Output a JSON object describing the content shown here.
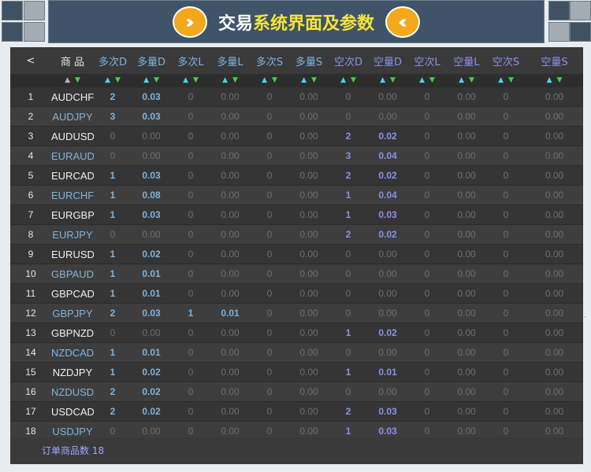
{
  "banner": {
    "title_white": "交易",
    "title_yellow": "系统界面及参数"
  },
  "header": {
    "back": "<",
    "product": "商 品",
    "columns": [
      "多次D",
      "多量D",
      "多次L",
      "多量L",
      "多次S",
      "多量S",
      "空次D",
      "空量D",
      "空次L",
      "空量L",
      "空次S",
      "空量S"
    ]
  },
  "rows": [
    {
      "n": "1",
      "sym": "AUDCHF",
      "v": [
        "2",
        "0.03",
        "0",
        "0.00",
        "0",
        "0.00",
        "0",
        "0.00",
        "0",
        "0.00",
        "0",
        "0.00"
      ]
    },
    {
      "n": "2",
      "sym": "AUDJPY",
      "v": [
        "3",
        "0.03",
        "0",
        "0.00",
        "0",
        "0.00",
        "0",
        "0.00",
        "0",
        "0.00",
        "0",
        "0.00"
      ]
    },
    {
      "n": "3",
      "sym": "AUDUSD",
      "v": [
        "0",
        "0.00",
        "0",
        "0.00",
        "0",
        "0.00",
        "2",
        "0.02",
        "0",
        "0.00",
        "0",
        "0.00"
      ]
    },
    {
      "n": "4",
      "sym": "EURAUD",
      "v": [
        "0",
        "0.00",
        "0",
        "0.00",
        "0",
        "0.00",
        "3",
        "0.04",
        "0",
        "0.00",
        "0",
        "0.00"
      ]
    },
    {
      "n": "5",
      "sym": "EURCAD",
      "v": [
        "1",
        "0.03",
        "0",
        "0.00",
        "0",
        "0.00",
        "2",
        "0.02",
        "0",
        "0.00",
        "0",
        "0.00"
      ]
    },
    {
      "n": "6",
      "sym": "EURCHF",
      "v": [
        "1",
        "0.08",
        "0",
        "0.00",
        "0",
        "0.00",
        "1",
        "0.04",
        "0",
        "0.00",
        "0",
        "0.00"
      ]
    },
    {
      "n": "7",
      "sym": "EURGBP",
      "v": [
        "1",
        "0.03",
        "0",
        "0.00",
        "0",
        "0.00",
        "1",
        "0.03",
        "0",
        "0.00",
        "0",
        "0.00"
      ]
    },
    {
      "n": "8",
      "sym": "EURJPY",
      "v": [
        "0",
        "0.00",
        "0",
        "0.00",
        "0",
        "0.00",
        "2",
        "0.02",
        "0",
        "0.00",
        "0",
        "0.00"
      ]
    },
    {
      "n": "9",
      "sym": "EURUSD",
      "v": [
        "1",
        "0.02",
        "0",
        "0.00",
        "0",
        "0.00",
        "0",
        "0.00",
        "0",
        "0.00",
        "0",
        "0.00"
      ]
    },
    {
      "n": "10",
      "sym": "GBPAUD",
      "v": [
        "1",
        "0.01",
        "0",
        "0.00",
        "0",
        "0.00",
        "0",
        "0.00",
        "0",
        "0.00",
        "0",
        "0.00"
      ]
    },
    {
      "n": "11",
      "sym": "GBPCAD",
      "v": [
        "1",
        "0.01",
        "0",
        "0.00",
        "0",
        "0.00",
        "0",
        "0.00",
        "0",
        "0.00",
        "0",
        "0.00"
      ]
    },
    {
      "n": "12",
      "sym": "GBPJPY",
      "v": [
        "2",
        "0.03",
        "1",
        "0.01",
        "0",
        "0.00",
        "0",
        "0.00",
        "0",
        "0.00",
        "0",
        "0.00"
      ]
    },
    {
      "n": "13",
      "sym": "GBPNZD",
      "v": [
        "0",
        "0.00",
        "0",
        "0.00",
        "0",
        "0.00",
        "1",
        "0.02",
        "0",
        "0.00",
        "0",
        "0.00"
      ]
    },
    {
      "n": "14",
      "sym": "NZDCAD",
      "v": [
        "1",
        "0.01",
        "0",
        "0.00",
        "0",
        "0.00",
        "0",
        "0.00",
        "0",
        "0.00",
        "0",
        "0.00"
      ]
    },
    {
      "n": "15",
      "sym": "NZDJPY",
      "v": [
        "1",
        "0.02",
        "0",
        "0.00",
        "0",
        "0.00",
        "1",
        "0.01",
        "0",
        "0.00",
        "0",
        "0.00"
      ]
    },
    {
      "n": "16",
      "sym": "NZDUSD",
      "v": [
        "2",
        "0.02",
        "0",
        "0.00",
        "0",
        "0.00",
        "0",
        "0.00",
        "0",
        "0.00",
        "0",
        "0.00"
      ]
    },
    {
      "n": "17",
      "sym": "USDCAD",
      "v": [
        "2",
        "0.02",
        "0",
        "0.00",
        "0",
        "0.00",
        "2",
        "0.03",
        "0",
        "0.00",
        "0",
        "0.00"
      ]
    },
    {
      "n": "18",
      "sym": "USDJPY",
      "v": [
        "0",
        "0.00",
        "0",
        "0.00",
        "0",
        "0.00",
        "1",
        "0.03",
        "0",
        "0.00",
        "0",
        "0.00"
      ]
    }
  ],
  "footer": {
    "label": "订单商品数 18"
  },
  "colors": {
    "long": "#7fb3dc",
    "short": "#8f8fe8",
    "zero": "#6f6f6f",
    "accent": "#f2a81d"
  }
}
